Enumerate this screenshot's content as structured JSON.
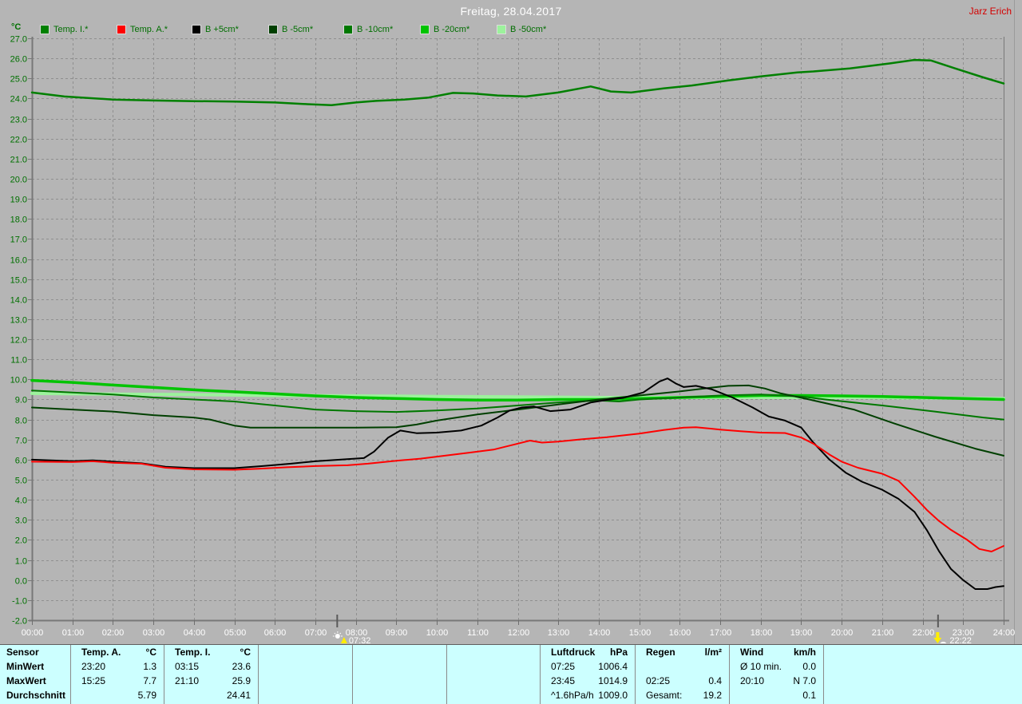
{
  "header": {
    "title": "Freitag, 28.04.2017",
    "user": "Jarz Erich",
    "user_color": "#d40000"
  },
  "legend_unit": "°C",
  "colors": {
    "background": "#b5b5b5",
    "grid": "#8f8f8f",
    "axis": "#787878",
    "y_tick_text": "#007000",
    "x_tick_text": "#ffffff",
    "table_bg": "#ccffff",
    "sun_marker": "#ffee00"
  },
  "chart_data": {
    "type": "line",
    "title": "Freitag, 28.04.2017",
    "ylabel": "°C",
    "ylim": [
      -2,
      27
    ],
    "y_step": 1,
    "grid": true,
    "legend_position": "top",
    "y_ticks": [
      "27.0",
      "26.0",
      "25.0",
      "24.0",
      "23.0",
      "22.0",
      "21.0",
      "20.0",
      "19.0",
      "18.0",
      "17.0",
      "16.0",
      "15.0",
      "14.0",
      "13.0",
      "12.0",
      "11.0",
      "10.0",
      "9.0",
      "8.0",
      "7.0",
      "6.0",
      "5.0",
      "4.0",
      "3.0",
      "2.0",
      "1.0",
      "0.0",
      "-1.0",
      "-2.0"
    ],
    "x_ticks": [
      "00:00",
      "01:00",
      "02:00",
      "03:00",
      "04:00",
      "05:00",
      "06:00",
      "07:00",
      "08:00",
      "09:00",
      "10:00",
      "11:00",
      "12:00",
      "13:00",
      "14:00",
      "15:00",
      "16:00",
      "17:00",
      "18:00",
      "19:00",
      "20:00",
      "21:00",
      "22:00",
      "23:00",
      "24:00"
    ],
    "sun_markers": [
      {
        "event": "sunrise",
        "time": "07:32",
        "hour": 7.53
      },
      {
        "event": "sunset",
        "time": "22:22",
        "hour": 22.37
      }
    ],
    "series": [
      {
        "name": "B -50cm*",
        "color": "#9cf29c",
        "width": 4,
        "points": [
          [
            0,
            9.3
          ],
          [
            2,
            9.27
          ],
          [
            4,
            9.24
          ],
          [
            6,
            9.2
          ],
          [
            8,
            9.18
          ],
          [
            10,
            9.15
          ],
          [
            12,
            9.13
          ],
          [
            14,
            9.1
          ],
          [
            16,
            9.1
          ],
          [
            18,
            9.1
          ],
          [
            20,
            9.1
          ],
          [
            22,
            9.08
          ],
          [
            24,
            9.05
          ]
        ]
      },
      {
        "name": "B -20cm*",
        "color": "#00c400",
        "width": 3.5,
        "points": [
          [
            0,
            9.95
          ],
          [
            1,
            9.85
          ],
          [
            2,
            9.72
          ],
          [
            3,
            9.6
          ],
          [
            4,
            9.48
          ],
          [
            5,
            9.38
          ],
          [
            6,
            9.28
          ],
          [
            7,
            9.18
          ],
          [
            8,
            9.1
          ],
          [
            9,
            9.05
          ],
          [
            10,
            9.0
          ],
          [
            11,
            8.97
          ],
          [
            12,
            8.97
          ],
          [
            13,
            9.0
          ],
          [
            14,
            9.0
          ],
          [
            15,
            9.05
          ],
          [
            16,
            9.1
          ],
          [
            17,
            9.15
          ],
          [
            18,
            9.2
          ],
          [
            19,
            9.2
          ],
          [
            20,
            9.18
          ],
          [
            21,
            9.15
          ],
          [
            22,
            9.1
          ],
          [
            23,
            9.05
          ],
          [
            24,
            9.0
          ]
        ]
      },
      {
        "name": "B -10cm*",
        "color": "#007800",
        "width": 2,
        "points": [
          [
            0,
            9.45
          ],
          [
            1,
            9.35
          ],
          [
            2,
            9.25
          ],
          [
            3,
            9.1
          ],
          [
            4,
            9.0
          ],
          [
            5,
            8.9
          ],
          [
            6,
            8.7
          ],
          [
            7,
            8.5
          ],
          [
            8,
            8.42
          ],
          [
            9,
            8.38
          ],
          [
            10,
            8.45
          ],
          [
            11,
            8.55
          ],
          [
            12,
            8.7
          ],
          [
            13,
            8.85
          ],
          [
            13.5,
            8.9
          ],
          [
            14,
            8.95
          ],
          [
            14.5,
            8.9
          ],
          [
            15,
            9.0
          ],
          [
            16,
            9.1
          ],
          [
            17,
            9.2
          ],
          [
            18,
            9.25
          ],
          [
            19,
            9.15
          ],
          [
            19.6,
            9.0
          ],
          [
            21,
            8.7
          ],
          [
            22.3,
            8.4
          ],
          [
            23.5,
            8.1
          ],
          [
            24,
            8.0
          ]
        ]
      },
      {
        "name": "B -5cm*",
        "color": "#003f00",
        "width": 2,
        "points": [
          [
            0,
            8.6
          ],
          [
            1,
            8.5
          ],
          [
            2,
            8.4
          ],
          [
            3,
            8.22
          ],
          [
            4,
            8.1
          ],
          [
            4.4,
            8.0
          ],
          [
            5,
            7.7
          ],
          [
            5.4,
            7.6
          ],
          [
            6,
            7.6
          ],
          [
            7,
            7.6
          ],
          [
            8,
            7.6
          ],
          [
            9,
            7.62
          ],
          [
            9.5,
            7.75
          ],
          [
            10,
            7.95
          ],
          [
            11,
            8.25
          ],
          [
            12,
            8.5
          ],
          [
            13,
            8.75
          ],
          [
            14,
            9.0
          ],
          [
            15,
            9.2
          ],
          [
            16,
            9.4
          ],
          [
            16.6,
            9.55
          ],
          [
            17.2,
            9.68
          ],
          [
            17.7,
            9.7
          ],
          [
            18.1,
            9.55
          ],
          [
            18.5,
            9.3
          ],
          [
            19.2,
            9.0
          ],
          [
            20.3,
            8.5
          ],
          [
            21.3,
            7.8
          ],
          [
            22.3,
            7.15
          ],
          [
            23.3,
            6.55
          ],
          [
            24,
            6.2
          ]
        ]
      },
      {
        "name": "B +5cm*",
        "color": "#000000",
        "width": 2,
        "points": [
          [
            0,
            6.0
          ],
          [
            1,
            5.93
          ],
          [
            1.5,
            5.97
          ],
          [
            2,
            5.9
          ],
          [
            2.7,
            5.82
          ],
          [
            3.3,
            5.65
          ],
          [
            4,
            5.58
          ],
          [
            5,
            5.58
          ],
          [
            5.7,
            5.68
          ],
          [
            6.4,
            5.8
          ],
          [
            7,
            5.92
          ],
          [
            7.6,
            6.0
          ],
          [
            8.2,
            6.08
          ],
          [
            8.45,
            6.4
          ],
          [
            8.8,
            7.1
          ],
          [
            9.1,
            7.45
          ],
          [
            9.5,
            7.32
          ],
          [
            10,
            7.35
          ],
          [
            10.6,
            7.45
          ],
          [
            11.1,
            7.7
          ],
          [
            11.5,
            8.1
          ],
          [
            11.8,
            8.45
          ],
          [
            12.1,
            8.6
          ],
          [
            12.4,
            8.65
          ],
          [
            12.8,
            8.42
          ],
          [
            13.3,
            8.5
          ],
          [
            13.8,
            8.85
          ],
          [
            14.2,
            8.98
          ],
          [
            14.6,
            9.08
          ],
          [
            15.1,
            9.35
          ],
          [
            15.5,
            9.9
          ],
          [
            15.7,
            10.05
          ],
          [
            15.9,
            9.8
          ],
          [
            16.1,
            9.62
          ],
          [
            16.4,
            9.68
          ],
          [
            16.8,
            9.5
          ],
          [
            17.3,
            9.1
          ],
          [
            17.8,
            8.6
          ],
          [
            18.2,
            8.15
          ],
          [
            18.6,
            7.95
          ],
          [
            19,
            7.6
          ],
          [
            19.3,
            6.85
          ],
          [
            19.7,
            6.0
          ],
          [
            20.1,
            5.35
          ],
          [
            20.5,
            4.9
          ],
          [
            21,
            4.5
          ],
          [
            21.4,
            4.05
          ],
          [
            21.8,
            3.4
          ],
          [
            22.1,
            2.5
          ],
          [
            22.4,
            1.45
          ],
          [
            22.7,
            0.55
          ],
          [
            23,
            0.0
          ],
          [
            23.3,
            -0.45
          ],
          [
            23.6,
            -0.45
          ],
          [
            23.8,
            -0.35
          ],
          [
            24,
            -0.3
          ]
        ]
      },
      {
        "name": "Temp. A.*",
        "color": "#ff0000",
        "width": 2,
        "points": [
          [
            0,
            5.9
          ],
          [
            1,
            5.88
          ],
          [
            1.5,
            5.92
          ],
          [
            2,
            5.85
          ],
          [
            2.7,
            5.8
          ],
          [
            3.3,
            5.6
          ],
          [
            4,
            5.52
          ],
          [
            5,
            5.5
          ],
          [
            5.6,
            5.55
          ],
          [
            6.3,
            5.62
          ],
          [
            7,
            5.68
          ],
          [
            7.8,
            5.72
          ],
          [
            8.3,
            5.8
          ],
          [
            9,
            5.95
          ],
          [
            9.6,
            6.05
          ],
          [
            10.2,
            6.2
          ],
          [
            10.8,
            6.35
          ],
          [
            11.4,
            6.5
          ],
          [
            12,
            6.8
          ],
          [
            12.3,
            6.95
          ],
          [
            12.6,
            6.85
          ],
          [
            13,
            6.9
          ],
          [
            13.6,
            7.02
          ],
          [
            14.2,
            7.12
          ],
          [
            15,
            7.3
          ],
          [
            15.6,
            7.48
          ],
          [
            16.1,
            7.6
          ],
          [
            16.4,
            7.62
          ],
          [
            17,
            7.5
          ],
          [
            17.5,
            7.42
          ],
          [
            18,
            7.35
          ],
          [
            18.6,
            7.33
          ],
          [
            19,
            7.1
          ],
          [
            19.3,
            6.8
          ],
          [
            19.7,
            6.25
          ],
          [
            20,
            5.9
          ],
          [
            20.4,
            5.6
          ],
          [
            21,
            5.3
          ],
          [
            21.4,
            4.95
          ],
          [
            21.8,
            4.15
          ],
          [
            22.1,
            3.5
          ],
          [
            22.4,
            2.95
          ],
          [
            22.7,
            2.5
          ],
          [
            23.1,
            2.0
          ],
          [
            23.4,
            1.55
          ],
          [
            23.7,
            1.42
          ],
          [
            24,
            1.7
          ]
        ]
      },
      {
        "name": "Temp. I.*",
        "color": "#008000",
        "width": 2.5,
        "points": [
          [
            0,
            24.3
          ],
          [
            0.8,
            24.1
          ],
          [
            2,
            23.95
          ],
          [
            3,
            23.9
          ],
          [
            4,
            23.87
          ],
          [
            5,
            23.85
          ],
          [
            6,
            23.8
          ],
          [
            6.8,
            23.72
          ],
          [
            7.4,
            23.67
          ],
          [
            8,
            23.8
          ],
          [
            8.5,
            23.88
          ],
          [
            9.2,
            23.95
          ],
          [
            9.8,
            24.05
          ],
          [
            10.4,
            24.28
          ],
          [
            10.9,
            24.25
          ],
          [
            11.5,
            24.15
          ],
          [
            12.2,
            24.1
          ],
          [
            13,
            24.3
          ],
          [
            13.8,
            24.6
          ],
          [
            14.3,
            24.35
          ],
          [
            14.8,
            24.3
          ],
          [
            15.6,
            24.5
          ],
          [
            16.3,
            24.65
          ],
          [
            17.2,
            24.9
          ],
          [
            18,
            25.1
          ],
          [
            18.9,
            25.3
          ],
          [
            19.3,
            25.35
          ],
          [
            20.2,
            25.5
          ],
          [
            21.2,
            25.75
          ],
          [
            21.8,
            25.92
          ],
          [
            22.2,
            25.9
          ],
          [
            22.8,
            25.5
          ],
          [
            23.5,
            25.05
          ],
          [
            24,
            24.75
          ]
        ]
      }
    ],
    "legend_order": [
      "Temp. I.*",
      "Temp. A.*",
      "B +5cm*",
      "B -5cm*",
      "B -10cm*",
      "B -20cm*",
      "B -50cm*"
    ]
  },
  "stats_table": {
    "row_labels": [
      "Sensor",
      "MinWert",
      "MaxWert",
      "Durchschnitt"
    ],
    "columns": [
      {
        "header": "Temp. A.",
        "unit": "°C",
        "rows": [
          [
            "23:20",
            "1.3"
          ],
          [
            "15:25",
            "7.7"
          ],
          [
            "",
            "5.79"
          ]
        ]
      },
      {
        "header": "Temp. I.",
        "unit": "°C",
        "rows": [
          [
            "03:15",
            "23.6"
          ],
          [
            "21:10",
            "25.9"
          ],
          [
            "",
            "24.41"
          ]
        ]
      },
      {
        "header": "",
        "unit": "",
        "rows": [
          [
            "",
            ""
          ],
          [
            "",
            ""
          ],
          [
            "",
            ""
          ]
        ]
      },
      {
        "header": "",
        "unit": "",
        "rows": [
          [
            "",
            ""
          ],
          [
            "",
            ""
          ],
          [
            "",
            ""
          ]
        ]
      },
      {
        "header": "",
        "unit": "",
        "rows": [
          [
            "",
            ""
          ],
          [
            "",
            ""
          ],
          [
            "",
            ""
          ]
        ]
      },
      {
        "header": "Luftdruck",
        "unit": "hPa",
        "rows": [
          [
            "07:25",
            "1006.4"
          ],
          [
            "23:45",
            "1014.9"
          ],
          [
            "^1.6hPa/h",
            "1009.0"
          ]
        ]
      },
      {
        "header": "Regen",
        "unit": "l/m²",
        "rows": [
          [
            "",
            ""
          ],
          [
            "02:25",
            "0.4"
          ],
          [
            "Gesamt:",
            "19.2"
          ]
        ]
      },
      {
        "header": "Wind",
        "unit": "km/h",
        "rows": [
          [
            "Ø 10 min.",
            "0.0"
          ],
          [
            "20:10",
            "N 7.0"
          ],
          [
            "",
            "0.1"
          ]
        ]
      },
      {
        "header": "",
        "unit": "",
        "rows": [
          [
            "",
            ""
          ],
          [
            "",
            ""
          ],
          [
            "",
            ""
          ]
        ]
      }
    ]
  }
}
